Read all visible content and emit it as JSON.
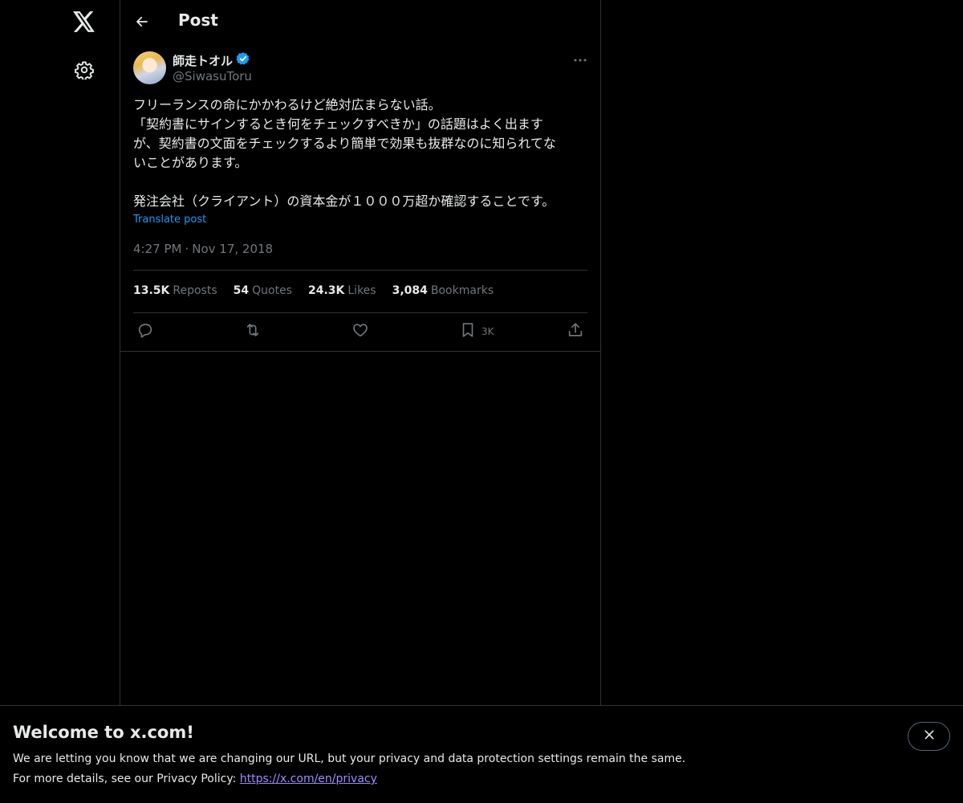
{
  "nav": {
    "logo_icon": "x-logo-icon",
    "settings_icon": "gear-icon"
  },
  "header": {
    "back_icon": "arrow-left-icon",
    "title": "Post"
  },
  "post": {
    "author": {
      "display_name": "師走トオル",
      "verified": true,
      "handle": "@SiwasuToru"
    },
    "more_icon": "ellipsis-icon",
    "text_lines": [
      "フリーランスの命にかかわるけど絶対広まらない話。",
      "「契約書にサインするとき何をチェックすべきか」の話題はよく出ます",
      "が、契約書の文面をチェックするより簡単で効果も抜群なのに知られてな",
      "いことがあります。",
      "",
      "発注会社（クライアント）の資本金が１０００万超か確認することです。"
    ],
    "translate_label": "Translate post",
    "time": "4:27 PM",
    "separator": "·",
    "date": "Nov 17, 2018",
    "stats": [
      {
        "value": "13.5K",
        "label": "Reposts"
      },
      {
        "value": "54",
        "label": "Quotes"
      },
      {
        "value": "24.3K",
        "label": "Likes"
      },
      {
        "value": "3,084",
        "label": "Bookmarks"
      }
    ],
    "actions": {
      "reply_icon": "reply-icon",
      "repost_icon": "repost-icon",
      "like_icon": "heart-icon",
      "bookmark_icon": "bookmark-icon",
      "bookmark_count": "3K",
      "share_icon": "share-icon"
    }
  },
  "banner": {
    "title": "Welcome to x.com!",
    "line1": "We are letting you know that we are changing our URL, but your privacy and data protection settings remain the same.",
    "line2_prefix": "For more details, see our Privacy Policy: ",
    "link": "https://x.com/en/privacy",
    "close_icon": "close-icon"
  },
  "colors": {
    "background": "#000000",
    "text": "#e7e9ea",
    "muted": "#71767b",
    "border": "#2f3336",
    "accent": "#1d9bf0",
    "link": "#a08bff"
  }
}
